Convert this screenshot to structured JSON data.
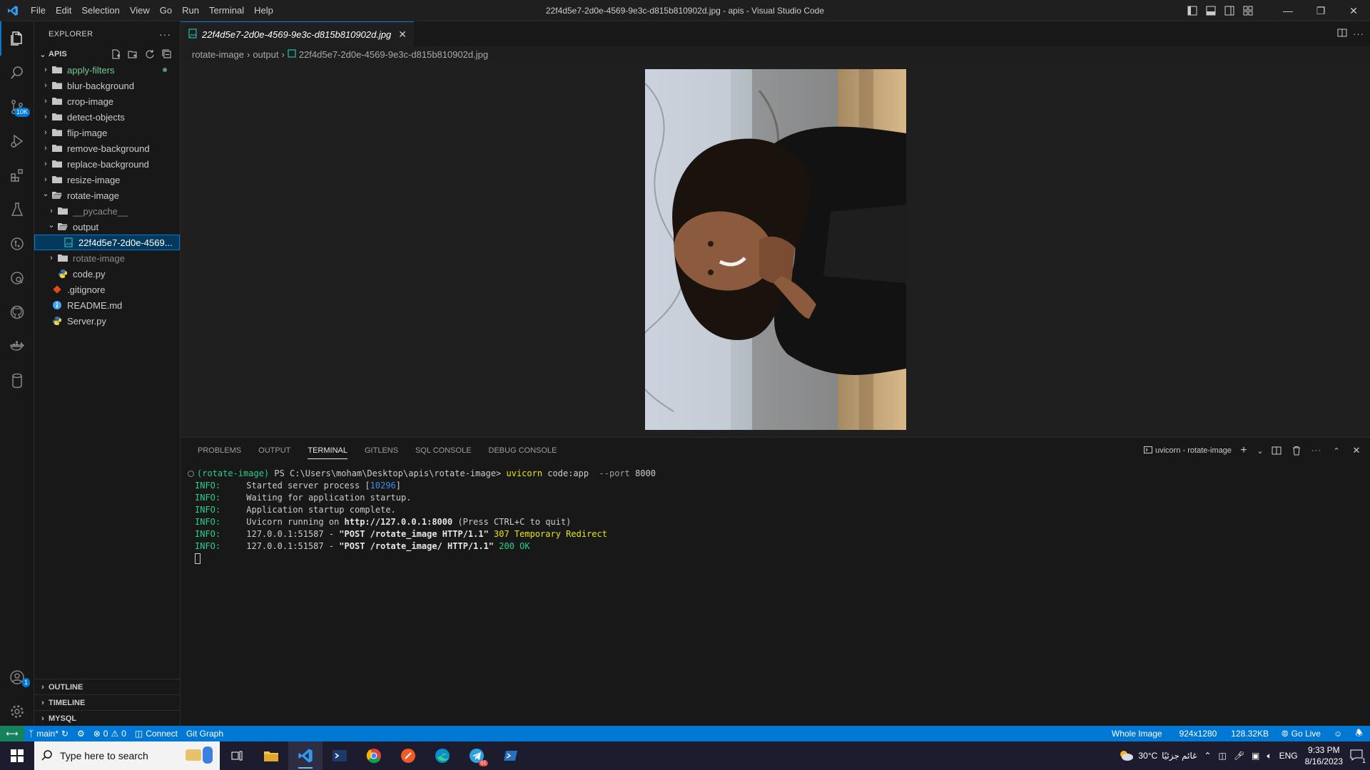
{
  "window": {
    "title": "22f4d5e7-2d0e-4569-9e3c-d815b810902d.jpg - apis - Visual Studio Code",
    "menu": [
      "File",
      "Edit",
      "Selection",
      "View",
      "Go",
      "Run",
      "Terminal",
      "Help"
    ]
  },
  "activity": {
    "scm_badge": "10K",
    "accounts_badge": "1"
  },
  "sidebar": {
    "title": "EXPLORER",
    "root": "APIS",
    "items": [
      {
        "label": "apply-filters",
        "type": "folder",
        "level": 0
      },
      {
        "label": "blur-background",
        "type": "folder",
        "level": 0
      },
      {
        "label": "crop-image",
        "type": "folder",
        "level": 0
      },
      {
        "label": "detect-objects",
        "type": "folder",
        "level": 0
      },
      {
        "label": "flip-image",
        "type": "folder",
        "level": 0
      },
      {
        "label": "remove-background",
        "type": "folder",
        "level": 0
      },
      {
        "label": "replace-background",
        "type": "folder",
        "level": 0
      },
      {
        "label": "resize-image",
        "type": "folder",
        "level": 0
      },
      {
        "label": "rotate-image",
        "type": "folder-open",
        "level": 0
      },
      {
        "label": "__pycache__",
        "type": "folder",
        "level": 1
      },
      {
        "label": "output",
        "type": "folder-open",
        "level": 1
      },
      {
        "label": "22f4d5e7-2d0e-4569...",
        "type": "image",
        "level": 2
      },
      {
        "label": "rotate-image",
        "type": "folder",
        "level": 1
      },
      {
        "label": "code.py",
        "type": "python",
        "level": 1
      },
      {
        "label": ".gitignore",
        "type": "git",
        "level": 0
      },
      {
        "label": "README.md",
        "type": "info",
        "level": 0
      },
      {
        "label": "Server.py",
        "type": "python",
        "level": 0
      }
    ],
    "bottom_sections": [
      "OUTLINE",
      "TIMELINE",
      "MYSQL"
    ]
  },
  "editor": {
    "tab_label": "22f4d5e7-2d0e-4569-9e3c-d815b810902d.jpg",
    "breadcrumb": [
      "rotate-image",
      "output",
      "22f4d5e7-2d0e-4569-9e3c-d815b810902d.jpg"
    ]
  },
  "panel": {
    "tabs": [
      "PROBLEMS",
      "OUTPUT",
      "TERMINAL",
      "GITLENS",
      "SQL CONSOLE",
      "DEBUG CONSOLE"
    ],
    "active_tab": "TERMINAL",
    "terminal_name": "uvicorn - rotate-image",
    "prompt_env": "(rotate-image)",
    "prompt_path": " PS C:\\Users\\moham\\Desktop\\apis\\rotate-image> ",
    "prompt_cmd": "uvicorn",
    "prompt_args": " code:app ",
    "prompt_flag": " --port ",
    "prompt_port": "8000",
    "lines": [
      {
        "level": "INFO:",
        "text": "     Started server process [",
        "num": "10296",
        "tail": "]"
      },
      {
        "level": "INFO:",
        "text": "     Waiting for application startup."
      },
      {
        "level": "INFO:",
        "text": "     Application startup complete."
      },
      {
        "level": "INFO:",
        "text": "     Uvicorn running on ",
        "bold": "http://127.0.0.1:8000",
        "tail": " (Press CTRL+C to quit)"
      },
      {
        "level": "INFO:",
        "text": "     127.0.0.1:51587 - ",
        "bold": "\"POST /rotate_image HTTP/1.1\"",
        "status": " 307 Temporary Redirect",
        "status_color": "yellow"
      },
      {
        "level": "INFO:",
        "text": "     127.0.0.1:51587 - ",
        "bold": "\"POST /rotate_image/ HTTP/1.1\"",
        "status": " 200 OK",
        "status_color": "green"
      }
    ]
  },
  "statusbar": {
    "branch": "main*",
    "errors": "0",
    "warnings": "0",
    "connect": "Connect",
    "git_graph": "Git Graph",
    "whole_image": "Whole Image",
    "dimensions": "924x1280",
    "size": "128.32KB",
    "go_live": "Go Live"
  },
  "taskbar": {
    "search_placeholder": "Type here to search",
    "weather": "30°C",
    "weather_text": "غائم جزئيًا",
    "lang": "ENG",
    "time": "9:33 PM",
    "date": "8/16/2023",
    "notif_count": "1",
    "telegram_badge": "65"
  },
  "colors": {
    "accent": "#0078d4",
    "statusbar": "#0078d4",
    "terminal_green": "#23d18b",
    "terminal_yellow": "#e5e510"
  }
}
